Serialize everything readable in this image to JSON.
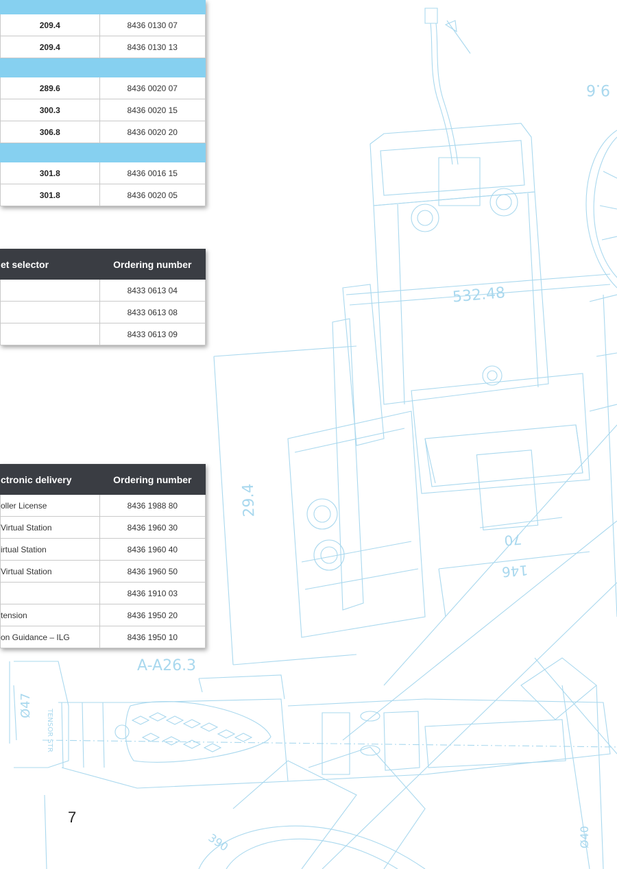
{
  "colors": {
    "band": "#86d0f0",
    "header": "#3a3d43",
    "blueprint": "#a9d8ee"
  },
  "drawing_labels": [
    "9.6",
    "532.48",
    "29.4",
    "70",
    "146",
    "A-A26.3",
    "Ø47",
    "Ø40",
    "390",
    "TENSOR STR"
  ],
  "table1": {
    "group1": [
      {
        "value": "209.4",
        "ordering": "8436 0130 07"
      },
      {
        "value": "209.4",
        "ordering": "8436 0130 13"
      }
    ],
    "group2": [
      {
        "value": "289.6",
        "ordering": "8436 0020 07"
      },
      {
        "value": "300.3",
        "ordering": "8436 0020 15"
      },
      {
        "value": "306.8",
        "ordering": "8436 0020 20"
      }
    ],
    "group3": [
      {
        "value": "301.8",
        "ordering": "8436 0016 15"
      },
      {
        "value": "301.8",
        "ordering": "8436 0020 05"
      }
    ]
  },
  "table2": {
    "header": "et selector",
    "ordering_header": "Ordering number",
    "rows": [
      {
        "ordering": "8433 0613 04"
      },
      {
        "ordering": "8433 0613 08"
      },
      {
        "ordering": "8433 0613 09"
      }
    ]
  },
  "table3": {
    "header": "ctronic delivery",
    "ordering_header": "Ordering number",
    "rows": [
      {
        "label": "oller License",
        "ordering": "8436 1988 80"
      },
      {
        "label": "Virtual Station",
        "ordering": "8436 1960 30"
      },
      {
        "label": "irtual Station",
        "ordering": "8436 1960 40"
      },
      {
        "label": "Virtual Station",
        "ordering": "8436 1960 50"
      },
      {
        "label": "",
        "ordering": "8436 1910 03"
      },
      {
        "label": "tension",
        "ordering": "8436 1950 20"
      },
      {
        "label": "on Guidance – ILG",
        "ordering": "8436 1950 10"
      }
    ]
  },
  "page_number": "7"
}
